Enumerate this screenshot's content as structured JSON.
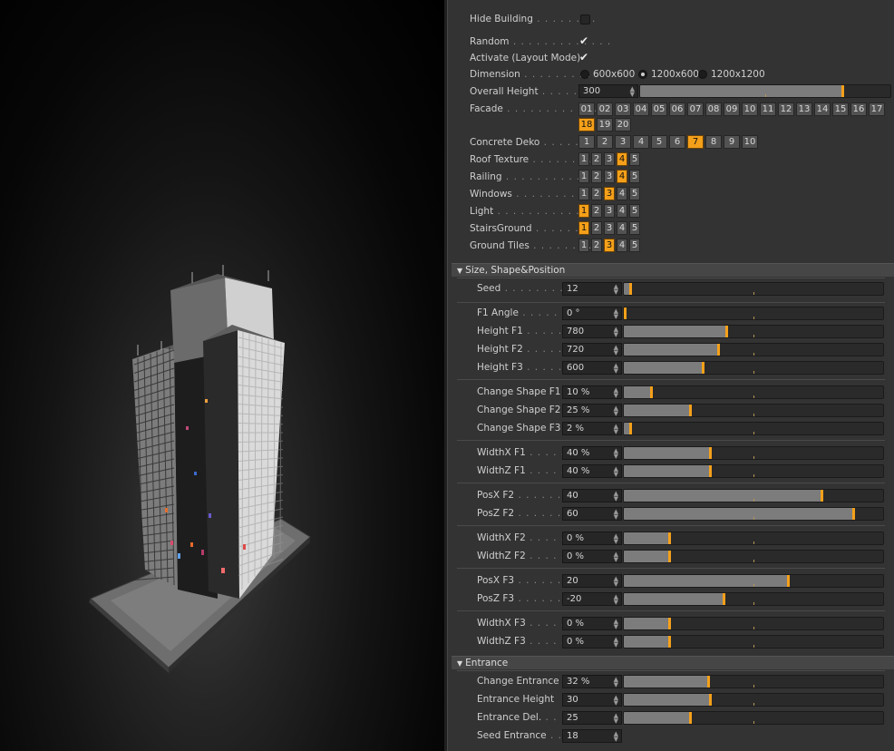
{
  "top": {
    "hide_building": {
      "label": "Hide Building",
      "dots": " . . . . . . . . ",
      "checked": false
    },
    "random": {
      "label": "Random",
      "dots": " . . . . . . . . . . . . . ",
      "checked": true
    },
    "activate": {
      "label": "Activate (Layout Mode)",
      "checked": true
    },
    "dimension": {
      "label": "Dimension",
      "dots": " . . . . . . . . . . ",
      "options": [
        "600x600",
        "1200x600",
        "1200x1200"
      ],
      "selected": "1200x600"
    },
    "overall_height": {
      "label": "Overall Height",
      "dots": " . . . . . . . ",
      "value": "300",
      "level": 0.805
    },
    "facade": {
      "label": "Facade",
      "dots": " . . . . . . . . . . . . . . ",
      "row1": [
        "01",
        "02",
        "03",
        "04",
        "05",
        "06",
        "07",
        "08",
        "09",
        "10",
        "11",
        "12",
        "13",
        "14",
        "15",
        "16",
        "17"
      ],
      "row2": [
        "18",
        "19",
        "20"
      ],
      "selected": "18"
    },
    "concrete_deko": {
      "label": "Concrete Deko",
      "dots": " . . . . . . . ",
      "options": [
        "1",
        "2",
        "3",
        "4",
        "5",
        "6",
        "7",
        "8",
        "9",
        "10"
      ],
      "selected": "7"
    },
    "roof_texture": {
      "label": "Roof Texture",
      "dots": " . . . . . . . . ",
      "options": [
        "1",
        "2",
        "3",
        "4",
        "5"
      ],
      "selected": "4"
    },
    "railing": {
      "label": "Railing",
      "dots": " . . . . . . . . . . . . . . ",
      "options": [
        "1",
        "2",
        "3",
        "4",
        "5"
      ],
      "selected": "4"
    },
    "windows": {
      "label": "Windows",
      "dots": " . . . . . . . . . . . . . ",
      "options": [
        "1",
        "2",
        "3",
        "4",
        "5"
      ],
      "selected": "3"
    },
    "light": {
      "label": "Light",
      "dots": " . . . . . . . . . . . . . . . . ",
      "options": [
        "1",
        "2",
        "3",
        "4",
        "5"
      ],
      "selected": "1"
    },
    "stairs_ground": {
      "label": "StairsGround",
      "dots": " . . . . . . . . ",
      "options": [
        "1",
        "2",
        "3",
        "4",
        "5"
      ],
      "selected": "1"
    },
    "ground_tiles": {
      "label": "Ground Tiles",
      "dots": " . . . . . . . . ",
      "options": [
        "1",
        "2",
        "3",
        "4",
        "5"
      ],
      "selected": "3"
    }
  },
  "sections": {
    "size": {
      "title": "Size, Shape&Position",
      "seed": {
        "label": "Seed",
        "dots": " . . . . . . . . . . ",
        "value": "12",
        "level": 0.02
      },
      "f1_angle": {
        "label": "F1 Angle",
        "dots": " . . . . . . . ",
        "value": "0 °",
        "level": 0.0
      },
      "height_f1": {
        "label": "Height F1",
        "dots": " . . . . . . ",
        "value": "780",
        "level": 0.39
      },
      "height_f2": {
        "label": "Height F2",
        "dots": " . . . . . . ",
        "value": "720",
        "level": 0.36
      },
      "height_f3": {
        "label": "Height F3",
        "dots": " . . . . . . ",
        "value": "600",
        "level": 0.3
      },
      "change_f1": {
        "label": "Change Shape F1",
        "value": "10 %",
        "level": 0.1
      },
      "change_f2": {
        "label": "Change Shape F2",
        "value": "25 %",
        "level": 0.25
      },
      "change_f3": {
        "label": "Change Shape F3",
        "value": "2 %",
        "level": 0.02
      },
      "widthx_f1": {
        "label": "WidthX F1",
        "dots": " . . . . . . ",
        "value": "40 %",
        "level": 0.33
      },
      "widthz_f1": {
        "label": "WidthZ F1",
        "dots": " . . . . . . ",
        "value": "40 %",
        "level": 0.33
      },
      "posx_f2": {
        "label": "PosX F2",
        "dots": " . . . . . . . . ",
        "value": "40",
        "level": 0.76
      },
      "posz_f2": {
        "label": "PosZ F2",
        "dots": " . . . . . . . . ",
        "value": "60",
        "level": 0.88
      },
      "widthx_f2": {
        "label": "WidthX F2",
        "dots": " . . . . . . ",
        "value": "0 %",
        "level": 0.17
      },
      "widthz_f2": {
        "label": "WidthZ F2",
        "dots": " . . . . . . ",
        "value": "0 %",
        "level": 0.17
      },
      "posx_f3": {
        "label": "PosX F3",
        "dots": " . . . . . . . . ",
        "value": "20",
        "level": 0.63
      },
      "posz_f3": {
        "label": "PosZ F3",
        "dots": " . . . . . . . . ",
        "value": "-20",
        "level": 0.38
      },
      "widthx_f3": {
        "label": "WidthX F3",
        "dots": " . . . . . . ",
        "value": "0 %",
        "level": 0.17
      },
      "widthz_f3": {
        "label": "WidthZ F3",
        "dots": " . . . . . . ",
        "value": "0 %",
        "level": 0.17
      }
    },
    "entrance": {
      "title": "Entrance",
      "change_entrance": {
        "label": "Change Entrance",
        "value": "32 %",
        "level": 0.32
      },
      "entrance_height": {
        "label": "Entrance Height",
        "value": "30",
        "level": 0.33
      },
      "entrance_del": {
        "label": "Entrance Del.",
        "dots": " . . . . ",
        "value": "25",
        "level": 0.25
      },
      "seed_entrance": {
        "label": "Seed Entrance",
        "dots": " . . . ",
        "value": "18"
      }
    }
  },
  "colors": {
    "accent": "#f5a01a",
    "panel_bg": "#333333",
    "viewport_bg": "#0a0a0a"
  }
}
